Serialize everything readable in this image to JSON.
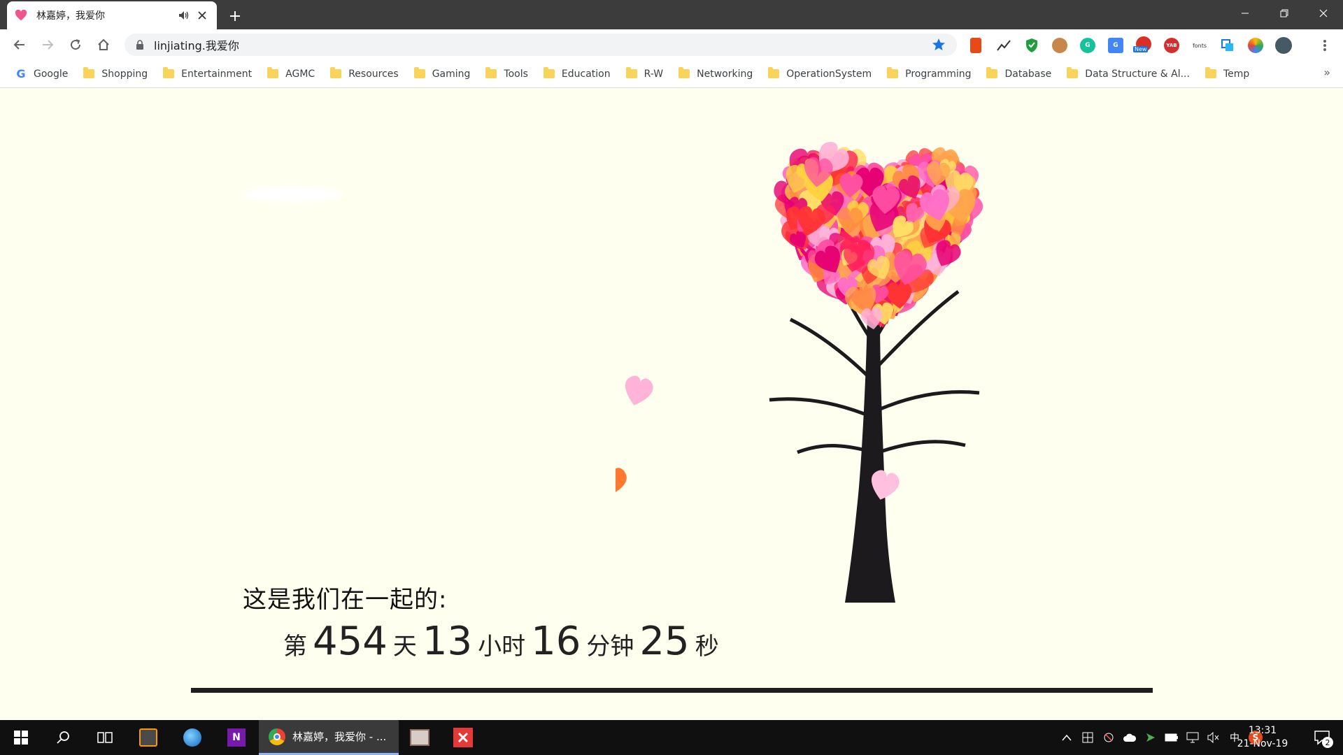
{
  "tab": {
    "title": "林嘉婷，我爱你",
    "favicon": "heart-icon"
  },
  "toolbar": {
    "url": "linjiating.我爱你"
  },
  "bookmarks": {
    "items": [
      {
        "label": "Google",
        "icon": "google-icon"
      },
      {
        "label": "Shopping",
        "icon": "folder-icon"
      },
      {
        "label": "Entertainment",
        "icon": "folder-icon"
      },
      {
        "label": "AGMC",
        "icon": "folder-icon"
      },
      {
        "label": "Resources",
        "icon": "folder-icon"
      },
      {
        "label": "Gaming",
        "icon": "folder-icon"
      },
      {
        "label": "Tools",
        "icon": "folder-icon"
      },
      {
        "label": "Education",
        "icon": "folder-icon"
      },
      {
        "label": "R-W",
        "icon": "folder-icon"
      },
      {
        "label": "Networking",
        "icon": "folder-icon"
      },
      {
        "label": "OperationSystem",
        "icon": "folder-icon"
      },
      {
        "label": "Programming",
        "icon": "folder-icon"
      },
      {
        "label": "Database",
        "icon": "folder-icon"
      },
      {
        "label": "Data Structure & Al...",
        "icon": "folder-icon"
      },
      {
        "label": "Temp",
        "icon": "folder-icon"
      }
    ],
    "more": "»"
  },
  "extensions": {
    "new_badge": "New",
    "yab_label": "YAB",
    "fonts_label": "fonts"
  },
  "page": {
    "caption": "这是我们在一起的:",
    "counter": {
      "prefix": "第",
      "days": "454",
      "days_unit": "天",
      "hours": "13",
      "hours_unit": "小时",
      "minutes": "16",
      "minutes_unit": "分钟",
      "seconds": "25",
      "seconds_unit": "秒"
    }
  },
  "taskbar": {
    "chrome_label": "林嘉婷，我爱你 - ...",
    "ime": "中",
    "time": "13:31",
    "date": "21-Nov-19",
    "notification_count": "2"
  },
  "colors": {
    "page_bg": "#fffff0",
    "heart_palette": [
      "#ff1f5a",
      "#ff4fa3",
      "#ff8a3d",
      "#ffd23f",
      "#ff6ec7",
      "#ff3333",
      "#ffb3d9",
      "#ffa64d",
      "#e60073",
      "#ffe066"
    ]
  }
}
